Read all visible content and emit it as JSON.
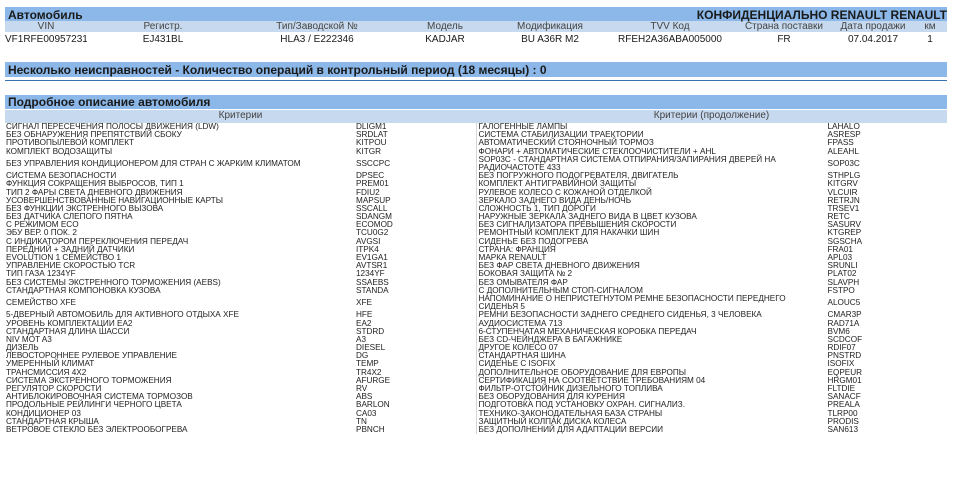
{
  "header": {
    "title": "Автомобиль",
    "confidential": "КОНФИДЕНЦИАЛЬНО RENAULT RENAULT"
  },
  "vehicle": {
    "cols": [
      "VIN",
      "Регистр.",
      "Тип/Заводской №",
      "Модель",
      "Модификация",
      "TVV Код",
      "Страна поставки",
      "Дата продажи",
      "км"
    ],
    "vals": [
      "VF1RFE00957231401",
      "EJ431BL",
      "HLA3 / E222346",
      "KADJAR",
      "BU A36R M2",
      "RFEH2A36ABA005000",
      "FR",
      "07.04.2017",
      "1"
    ]
  },
  "summary": "Несколько неисправностей - Количество операций в контрольный период (18 месяцы) : 0",
  "section_title": "Подробное описание автомобиля",
  "criteria": {
    "left": "Критерии",
    "right": "Критерии (продолжение)"
  },
  "rows": [
    {
      "l": "СИГНАЛ ПЕРЕСЕЧЕНИЯ ПОЛОСЫ ДВИЖЕНИЯ (LDW)",
      "lc": "DLIGM1",
      "r": "ГАЛОГЕННЫЕ ЛАМПЫ",
      "rc": "LAHALO"
    },
    {
      "l": "БЕЗ ОБНАРУЖЕНИЯ ПРЕПЯТСТВИЙ СБОКУ",
      "lc": "SRDLAT",
      "r": "СИСТЕМА СТАБИЛИЗАЦИИ ТРАЕКТОРИИ",
      "rc": "ASRESP"
    },
    {
      "l": "ПРОТИВОПЫЛЕВОЙ КОМПЛЕКТ",
      "lc": "KITPOU",
      "r": "АВТОМАТИЧЕСКИЙ СТОЯНОЧНЫЙ ТОРМОЗ",
      "rc": "FPASS"
    },
    {
      "l": "КОМПЛЕКТ ВОДОЗАЩИТЫ",
      "lc": "KITGR",
      "r": "ФОНАРИ + АВТОМАТИЧЕСКИЕ СТЕКЛООЧИСТИТЕЛИ + AHL",
      "rc": "ALEAHL"
    },
    {
      "l": "БЕЗ УПРАВЛЕНИЯ КОНДИЦИОНЕРОМ ДЛЯ СТРАН С ЖАРКИМ КЛИМАТОМ",
      "lc": "SSCCPC",
      "r": "SOP03C - СТАНДАРТНАЯ СИСТЕМА ОТПИРАНИЯ/ЗАПИРАНИЯ ДВЕРЕЙ НА РАДИОЧАСТОТЕ 433",
      "rc": "SOP03C",
      "tall": true
    },
    {
      "l": "СИСТЕМА БЕЗОПАСНОСТИ",
      "lc": "DPSEC",
      "r": "БЕЗ ПОГРУЖНОГО ПОДОГРЕВАТЕЛЯ, ДВИГАТЕЛЬ",
      "rc": "STHPLG"
    },
    {
      "l": "ФУНКЦИЯ СОКРАЩЕНИЯ ВЫБРОСОВ, ТИП 1",
      "lc": "PREM01",
      "r": "КОМПЛЕКТ АНТИГРАВИЙНОЙ ЗАЩИТЫ",
      "rc": "KITGRV"
    },
    {
      "l": "ТИП 2 ФАРЫ СВЕТА ДНЕВНОГО ДВИЖЕНИЯ",
      "lc": "FDIU2",
      "r": "РУЛЕВОЕ КОЛЕСО С КОЖАНОЙ ОТДЕЛКОЙ",
      "rc": "VLCUIR"
    },
    {
      "l": "УСОВЕРШЕНСТВОВАННЫЕ НАВИГАЦИОННЫЕ КАРТЫ",
      "lc": "MAPSUP",
      "r": "ЗЕРКАЛО ЗАДНЕГО ВИДА ДЕНЬ/НОЧЬ",
      "rc": "RETRJN"
    },
    {
      "l": "БЕЗ ФУНКЦИИ ЭКСТРЕННОГО ВЫЗОВА",
      "lc": "SSCALL",
      "r": "СЛОЖНОСТЬ 1, ТИП ДОРОГИ",
      "rc": "TRSEV1"
    },
    {
      "l": "БЕЗ ДАТЧИКА СЛЕПОГО ПЯТНА",
      "lc": "SDANGM",
      "r": "НАРУЖНЫЕ ЗЕРКАЛА ЗАДНЕГО ВИДА В ЦВЕТ КУЗОВА",
      "rc": "RETC"
    },
    {
      "l": "С РЕЖИМОМ ECO",
      "lc": "ECOMOD",
      "r": "БЕЗ СИГНАЛИЗАТОРА ПРЕВЫШЕНИЯ СКОРОСТИ",
      "rc": "SASURV"
    },
    {
      "l": "ЭБУ ВЕР. 0 ПОК. 2",
      "lc": "TCU0G2",
      "r": "РЕМОНТНЫЙ КОМПЛЕКТ ДЛЯ НАКАЧКИ ШИН",
      "rc": "KTGREP"
    },
    {
      "l": "С ИНДИКАТОРОМ ПЕРЕКЛЮЧЕНИЯ ПЕРЕДАЧ",
      "lc": "AVGSI",
      "r": "СИДЕНЬЕ БЕЗ ПОДОГРЕВА",
      "rc": "SGSCHA"
    },
    {
      "l": "ПЕРЕДНИЙ + ЗАДНИЙ ДАТЧИКИ",
      "lc": "ITPK4",
      "r": "СТРАНА: ФРАНЦИЯ",
      "rc": "FRA01"
    },
    {
      "l": "EVOLUTION 1 СЕМЕЙСТВО 1",
      "lc": "EV1GA1",
      "r": "МАРКА RENAULT",
      "rc": "APL03"
    },
    {
      "l": "УПРАВЛЕНИЕ СКОРОСТЬЮ TCR",
      "lc": "AVTSR1",
      "r": "БЕЗ ФАР СВЕТА ДНЕВНОГО ДВИЖЕНИЯ",
      "rc": "SRUNLI"
    },
    {
      "l": "ТИП ГАЗА 1234YF",
      "lc": "1234YF",
      "r": "БОКОВАЯ ЗАЩИТА № 2",
      "rc": "PLAT02"
    },
    {
      "l": "БЕЗ СИСТЕМЫ ЭКСТРЕННОГО ТОРМОЖЕНИЯ (AEBS)",
      "lc": "SSAEBS",
      "r": "БЕЗ ОМЫВАТЕЛЯ ФАР",
      "rc": "SLAVPH"
    },
    {
      "l": "СТАНДАРТНАЯ КОМПОНОВКА КУЗОВА",
      "lc": "STANDA",
      "r": "С ДОПОЛНИТЕЛЬНЫМ СТОП-СИГНАЛОМ",
      "rc": "FSTPO"
    },
    {
      "l": "СЕМЕЙСТВО XFE",
      "lc": "XFE",
      "r": "НАПОМИНАНИЕ О НЕПРИСТЕГНУТОМ РЕМНЕ БЕЗОПАСНОСТИ ПЕРЕДНЕГО СИДЕНЬЯ 5",
      "rc": "ALOUC5",
      "tall": true
    },
    {
      "l": "5-ДВЕРНЫЙ АВТОМОБИЛЬ ДЛЯ АКТИВНОГО ОТДЫХА XFE",
      "lc": "HFE",
      "r": "РЕМНИ БЕЗОПАСНОСТИ ЗАДНЕГО СРЕДНЕГО СИДЕНЬЯ, 3 ЧЕЛОВЕКА",
      "rc": "CMAR3P"
    },
    {
      "l": "УРОВЕНЬ КОМПЛЕКТАЦИИ EA2",
      "lc": "EA2",
      "r": "АУДИОСИСТЕМА 713",
      "rc": "RAD71A"
    },
    {
      "l": "СТАНДАРТНАЯ ДЛИНА ШАССИ",
      "lc": "STDRD",
      "r": "6-СТУПЕНЧАТАЯ МЕХАНИЧЕСКАЯ КОРОБКА ПЕРЕДАЧ",
      "rc": "BVM6"
    },
    {
      "l": "NIV MOT A3",
      "lc": "A3",
      "r": "БЕЗ CD-ЧЕЙНДЖЕРА В БАГАЖНИКЕ",
      "rc": "SCDCOF"
    },
    {
      "l": "ДИЗЕЛЬ",
      "lc": "DIESEL",
      "r": "ДРУГОЕ КОЛЕСО 07",
      "rc": "RDIF07"
    },
    {
      "l": "ЛЕВОСТОРОННЕЕ РУЛЕВОЕ УПРАВЛЕНИЕ",
      "lc": "DG",
      "r": "СТАНДАРТНАЯ ШИНА",
      "rc": "PNSTRD"
    },
    {
      "l": "УМЕРЕННЫЙ КЛИМАТ",
      "lc": "TEMP",
      "r": "СИДЕНЬЕ С ISOFIX",
      "rc": "ISOFIX"
    },
    {
      "l": "ТРАНСМИССИЯ 4X2",
      "lc": "TR4X2",
      "r": "ДОПОЛНИТЕЛЬНОЕ ОБОРУДОВАНИЕ ДЛЯ ЕВРОПЫ",
      "rc": "EQPEUR"
    },
    {
      "l": "СИСТЕМА ЭКСТРЕННОГО ТОРМОЖЕНИЯ",
      "lc": "AFURGE",
      "r": "СЕРТИФИКАЦИЯ НА СООТВЕТСТВИЕ ТРЕБОВАНИЯМ 04",
      "rc": "HRGM01"
    },
    {
      "l": "РЕГУЛЯТОР СКОРОСТИ",
      "lc": "RV",
      "r": "ФИЛЬТР-ОТСТОЙНИК ДИЗЕЛЬНОГО ТОПЛИВА",
      "rc": "FLTDIE"
    },
    {
      "l": "АНТИБЛОКИРОВОЧНАЯ СИСТЕМА ТОРМОЗОВ",
      "lc": "ABS",
      "r": "БЕЗ ОБОРУДОВАНИЯ ДЛЯ КУРЕНИЯ",
      "rc": "SANACF"
    },
    {
      "l": "ПРОДОЛЬНЫЕ РЕЙЛИНГИ ЧЕРНОГО ЦВЕТА",
      "lc": "BARLON",
      "r": "ПОДГОТОВКА ПОД УСТАНОВКУ ОХРАН. СИГНАЛИЗ.",
      "rc": "PREALA"
    },
    {
      "l": "КОНДИЦИОНЕР 03",
      "lc": "CA03",
      "r": "ТЕХНИКО-ЗАКОНОДАТЕЛЬНАЯ БАЗА СТРАНЫ",
      "rc": "TLRP00"
    },
    {
      "l": "СТАНДАРТНАЯ КРЫША",
      "lc": "TN",
      "r": "ЗАЩИТНЫЙ КОЛПАК ДИСКА КОЛЕСА",
      "rc": "PRODIS"
    },
    {
      "l": "ВЕТРОВОЕ СТЕКЛО БЕЗ ЭЛЕКТРООБОГРЕВА",
      "lc": "PBNCH",
      "r": "БЕЗ ДОПОЛНЕНИЙ ДЛЯ АДАПТАЦИИ ВЕРСИИ",
      "rc": "SAN613"
    }
  ]
}
